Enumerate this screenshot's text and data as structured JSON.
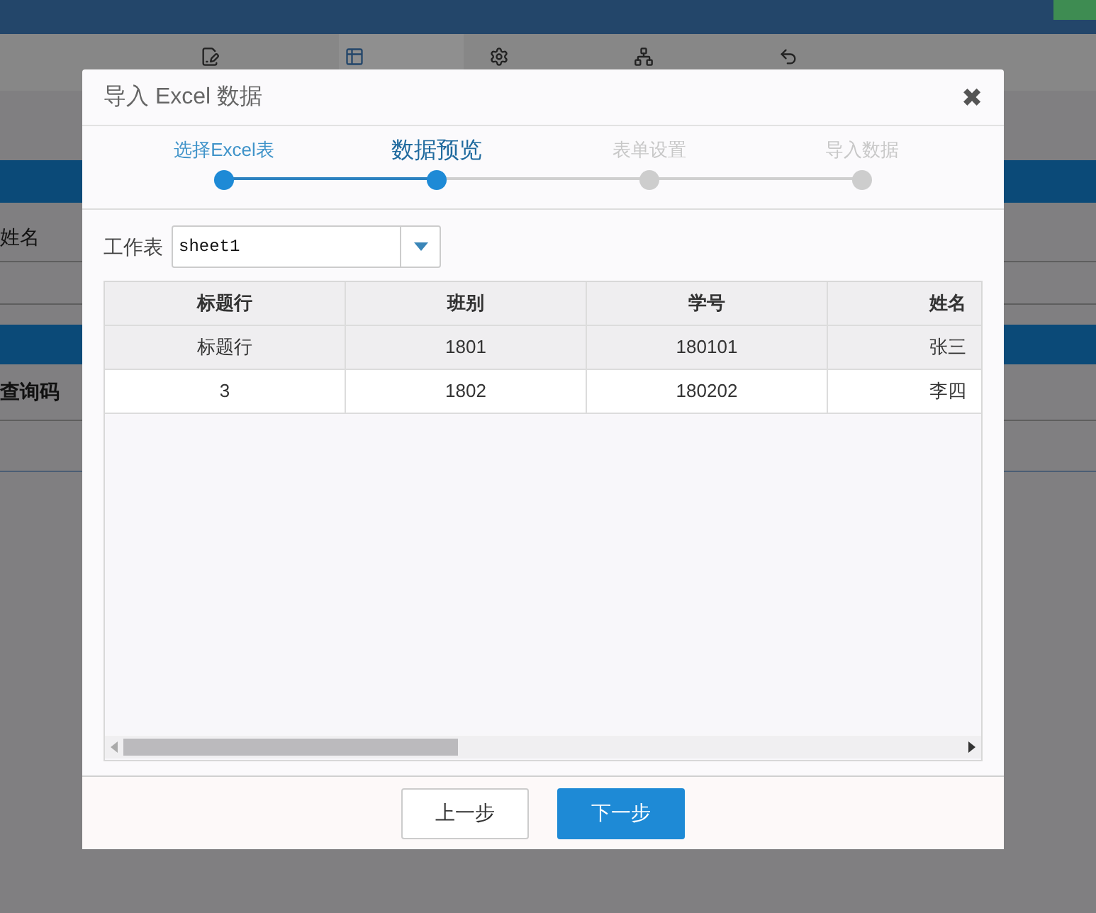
{
  "background": {
    "toolbar": [
      {
        "selected": false
      },
      {
        "selected": true
      },
      {
        "selected": false
      },
      {
        "selected": false
      },
      {
        "selected": false
      }
    ],
    "side_labels": [
      "姓名",
      "查询码"
    ]
  },
  "dialog": {
    "title": "导入 Excel 数据",
    "close": "✖",
    "steps": [
      {
        "label": "选择Excel表",
        "completed": true,
        "selected": false
      },
      {
        "label": "数据预览",
        "completed": true,
        "selected": true
      },
      {
        "label": "表单设置",
        "completed": false,
        "selected": false
      },
      {
        "label": "导入数据",
        "completed": false,
        "selected": false
      }
    ],
    "sheet": {
      "label": "工作表",
      "value": "sheet1"
    },
    "table": {
      "columns": [
        "标题行",
        "班别",
        "学号",
        "姓名"
      ],
      "rows": [
        {
          "cells": [
            "标题行",
            "1801",
            "180101",
            "张三"
          ],
          "selected": true
        },
        {
          "cells": [
            "3",
            "1802",
            "180202",
            "李四"
          ],
          "selected": false
        }
      ]
    },
    "buttons": [
      {
        "label": "上一步",
        "kind": "secondary"
      },
      {
        "label": "下一步",
        "kind": "primary"
      }
    ]
  }
}
